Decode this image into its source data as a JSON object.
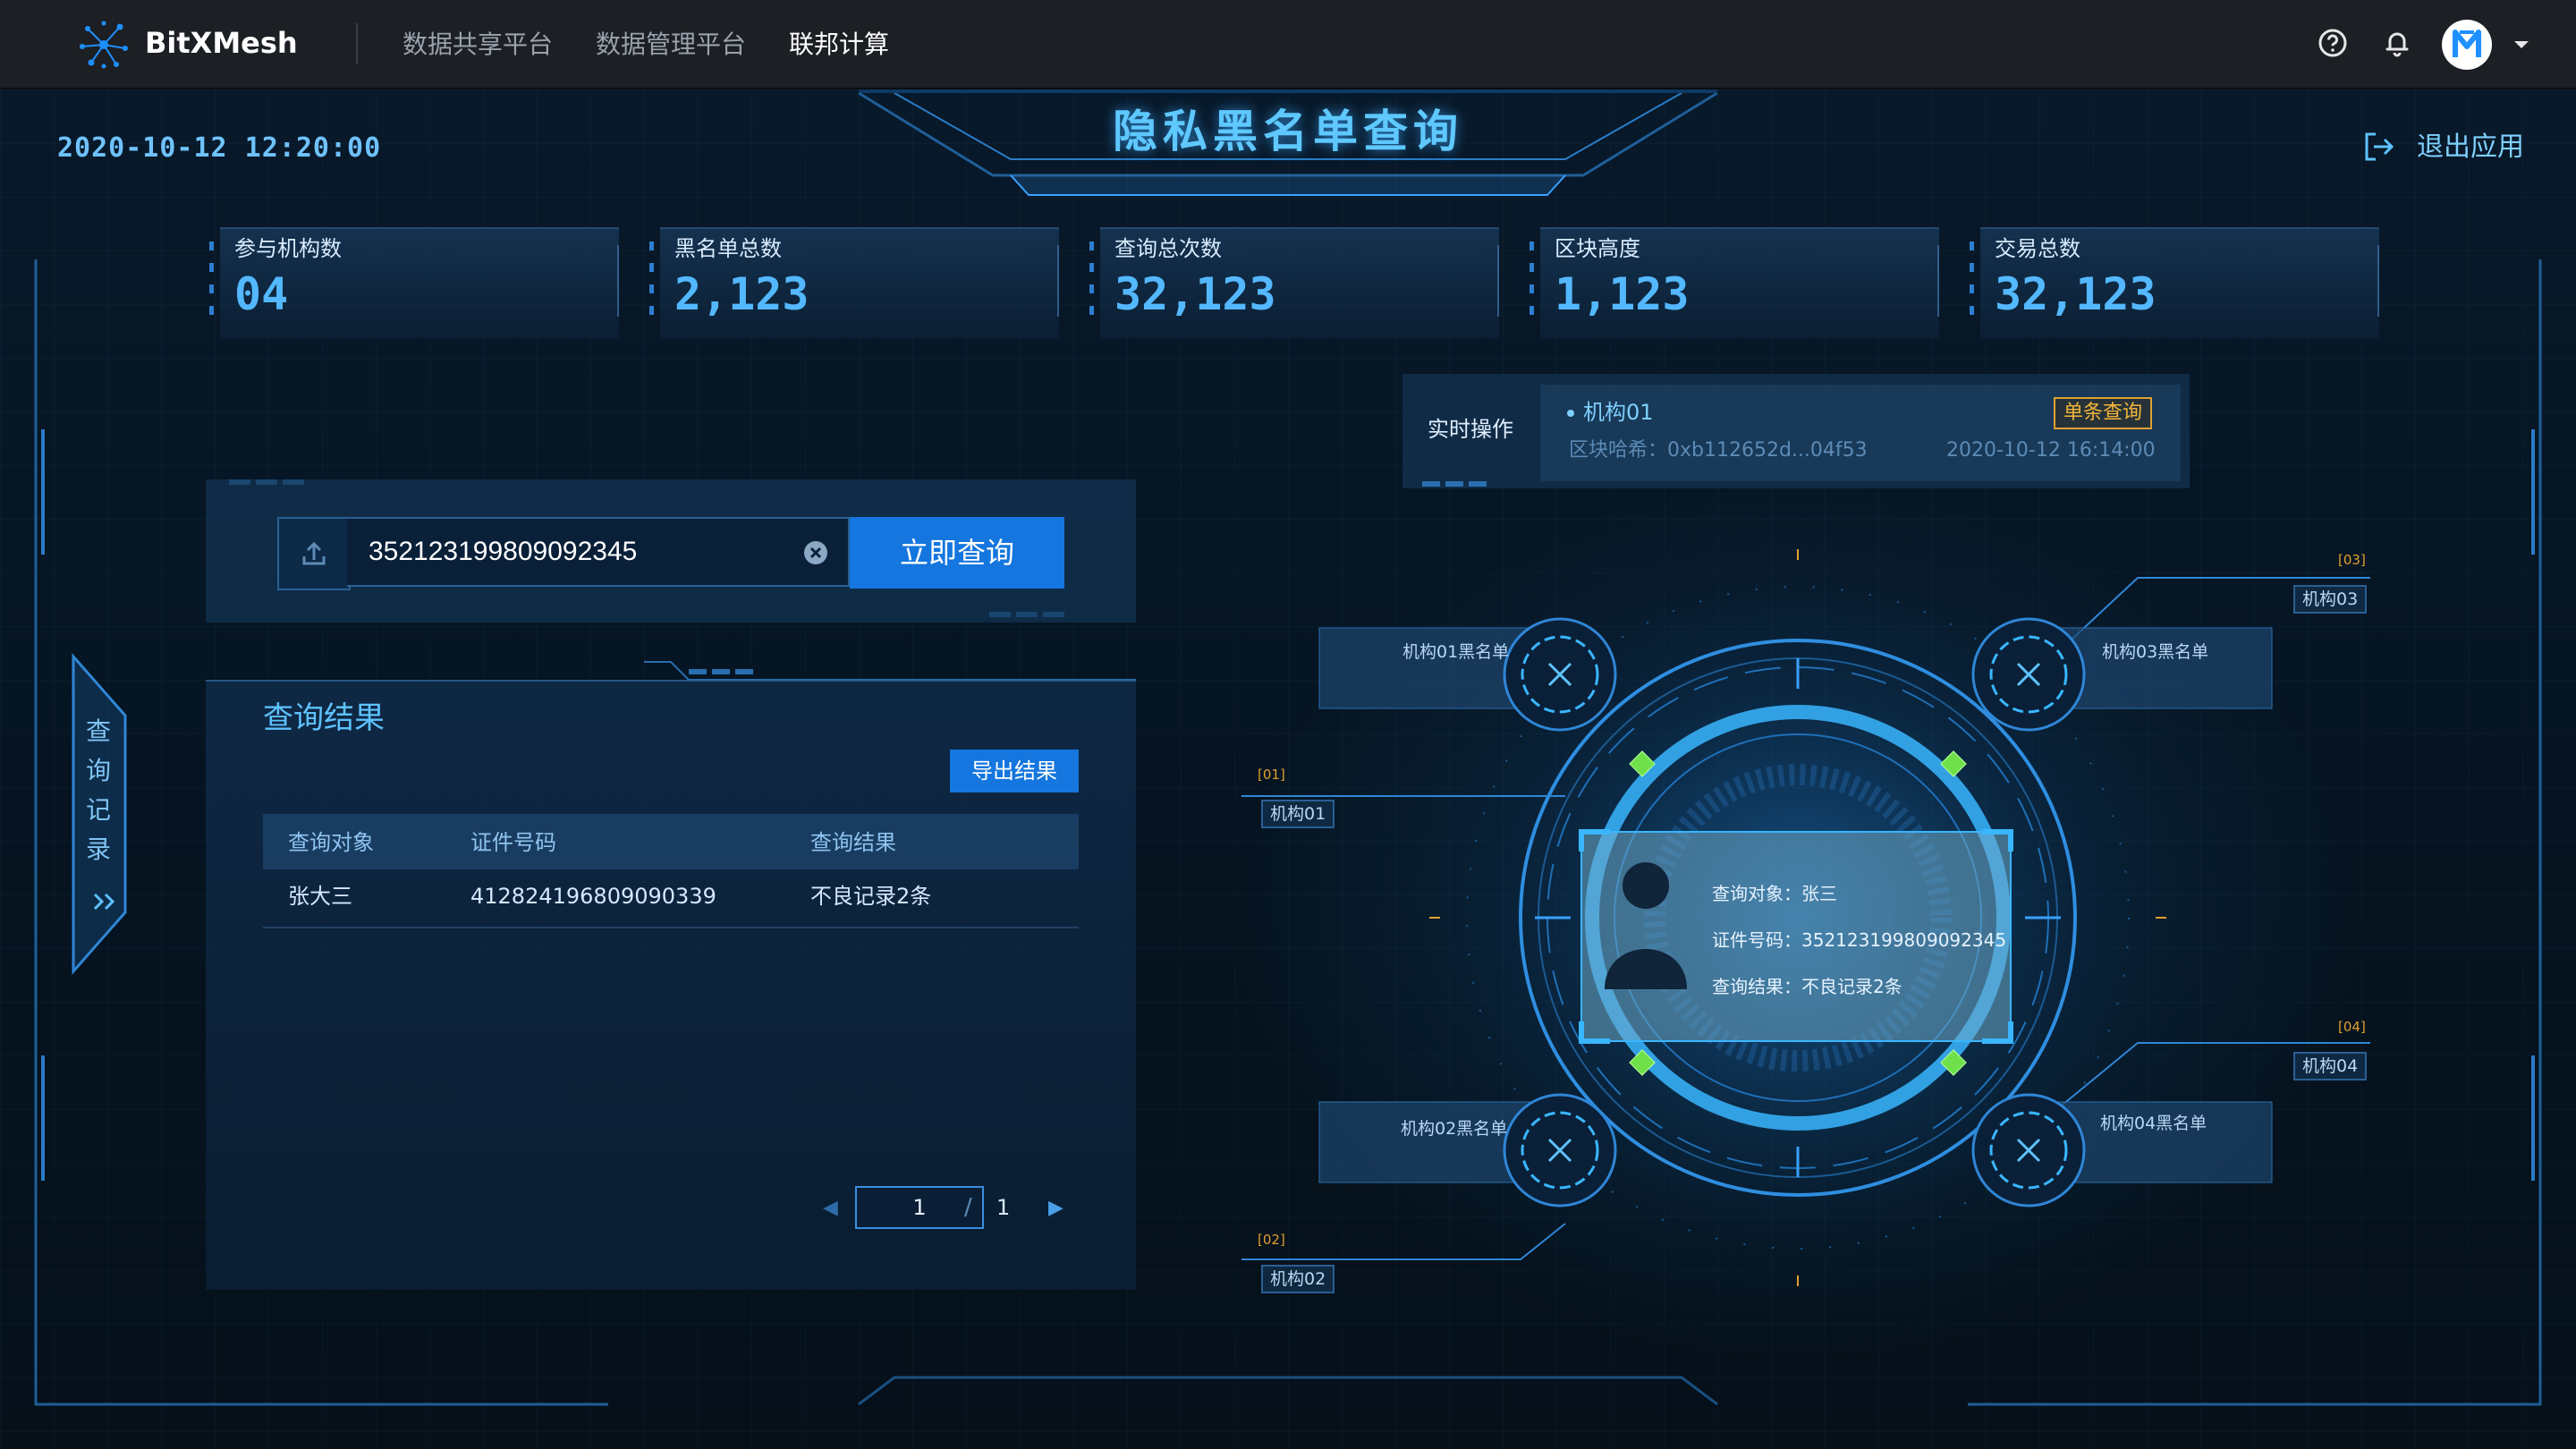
{
  "app": {
    "brand": "BitXMesh"
  },
  "nav": {
    "items": [
      "数据共享平台",
      "数据管理平台",
      "联邦计算"
    ],
    "active_index": 2
  },
  "header": {
    "datetime": "2020-10-12 12:20:00",
    "title": "隐私黑名单查询",
    "exit_label": "退出应用"
  },
  "stats": [
    {
      "label": "参与机构数",
      "value": "04"
    },
    {
      "label": "黑名单总数",
      "value": "2,123"
    },
    {
      "label": "查询总次数",
      "value": "32,123"
    },
    {
      "label": "区块高度",
      "value": "1,123"
    },
    {
      "label": "交易总数",
      "value": "32,123"
    }
  ],
  "search": {
    "value": "352123199809092345",
    "button_label": "立即查询"
  },
  "results": {
    "title": "查询结果",
    "export_label": "导出结果",
    "columns": [
      "查询对象",
      "证件号码",
      "查询结果"
    ],
    "rows": [
      [
        "张大三",
        "412824196809090339",
        "不良记录2条"
      ]
    ]
  },
  "pagination": {
    "current": "1",
    "separator": "/",
    "total": "1"
  },
  "side_tab": {
    "chars": [
      "查",
      "询",
      "记",
      "录"
    ]
  },
  "realtime": {
    "label": "实时操作",
    "org": "机构01",
    "hash": "区块哈希：0xb112652d...04f53",
    "time": "2020-10-12 16:14:00",
    "badge": "单条查询"
  },
  "radar": {
    "nodes": [
      {
        "blacklist": "机构01黑名单",
        "code": "[01]",
        "name": "机构01"
      },
      {
        "blacklist": "机构02黑名单",
        "code": "[02]",
        "name": "机构02"
      },
      {
        "blacklist": "机构03黑名单",
        "code": "[03]",
        "name": "机构03"
      },
      {
        "blacklist": "机构04黑名单",
        "code": "[04]",
        "name": "机构04"
      }
    ],
    "card": {
      "subject": "查询对象：张三",
      "id": "证件号码：352123199809092345",
      "result": "查询结果：不良记录2条"
    }
  },
  "colors": {
    "accent": "#1476de",
    "highlight": "#53b8ff",
    "warning": "#f5b53a",
    "node_green": "#6fe04a"
  }
}
